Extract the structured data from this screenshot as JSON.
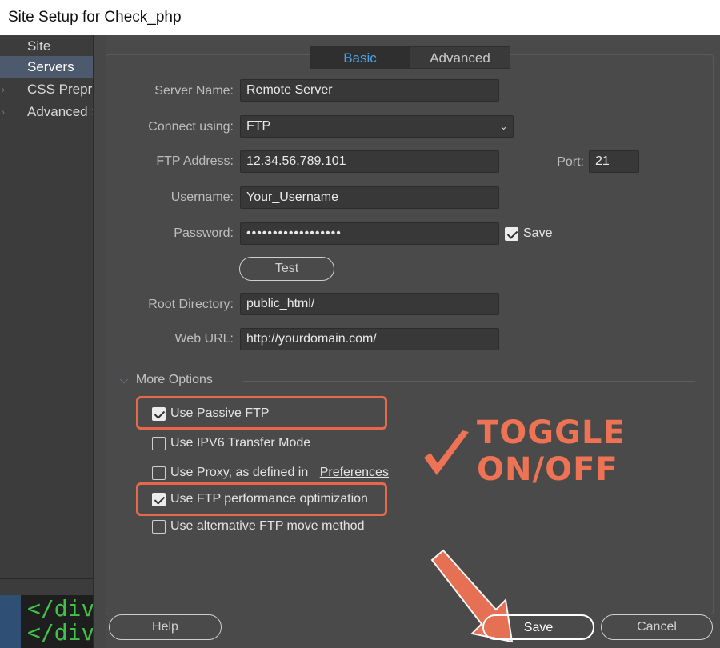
{
  "window": {
    "title": "Site Setup for Check_php"
  },
  "sidebar": {
    "items": [
      {
        "label": "Site",
        "selected": false,
        "expandable": false
      },
      {
        "label": "Servers",
        "selected": true,
        "expandable": false
      },
      {
        "label": "CSS Preprocessors",
        "selected": false,
        "expandable": true
      },
      {
        "label": "Advanced Settings",
        "selected": false,
        "expandable": true
      }
    ],
    "code_lines": [
      "</div",
      "</div"
    ]
  },
  "tabs": [
    {
      "label": "Basic",
      "active": true
    },
    {
      "label": "Advanced",
      "active": false
    }
  ],
  "form": {
    "server_name": {
      "label": "Server Name:",
      "value": "Remote Server"
    },
    "connect_using": {
      "label": "Connect using:",
      "value": "FTP"
    },
    "ftp_address": {
      "label": "FTP Address:",
      "value": "12.34.56.789.101"
    },
    "port": {
      "label": "Port:",
      "value": "21"
    },
    "username": {
      "label": "Username:",
      "value": "Your_Username"
    },
    "password": {
      "label": "Password:",
      "value": "••••••••••••••••••"
    },
    "save_password": {
      "label": "Save",
      "checked": true
    },
    "test_button": "Test",
    "root_directory": {
      "label": "Root Directory:",
      "value": "public_html/"
    },
    "web_url": {
      "label": "Web URL:",
      "value": "http://yourdomain.com/"
    }
  },
  "more_options": {
    "label": "More Options",
    "options": [
      {
        "label": "Use Passive FTP",
        "checked": true
      },
      {
        "label": "Use IPV6 Transfer Mode",
        "checked": false
      },
      {
        "label": "Use Proxy, as defined in",
        "link": "Preferences",
        "checked": false
      },
      {
        "label": "Use FTP performance optimization",
        "checked": true
      },
      {
        "label": "Use alternative FTP move method",
        "checked": false
      }
    ]
  },
  "annotation": {
    "text": "TOGGLE\nON/OFF",
    "color": "#ee7354"
  },
  "buttons": {
    "help": "Help",
    "save": "Save",
    "cancel": "Cancel"
  },
  "colors": {
    "accent_tab": "#4ea1e6",
    "highlight": "#e6694c",
    "selected_nav": "#4d5a6d"
  }
}
